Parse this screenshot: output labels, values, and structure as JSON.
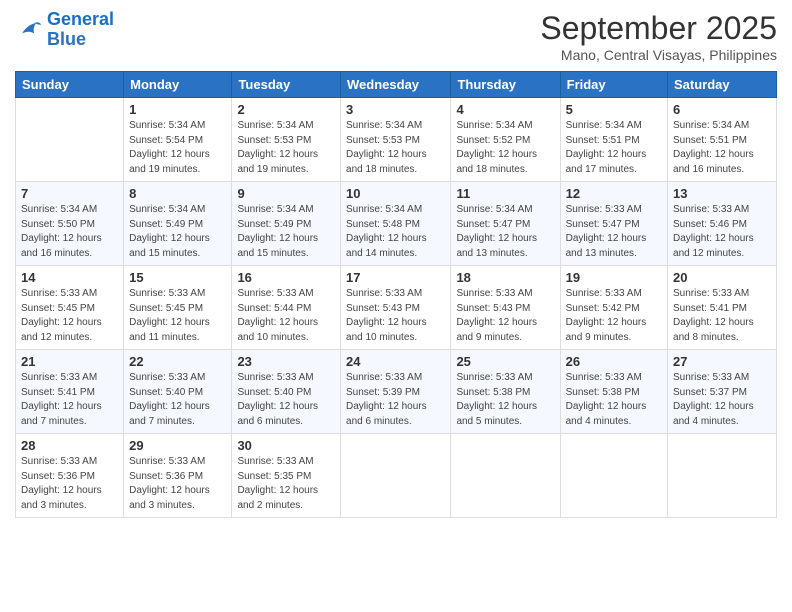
{
  "header": {
    "logo_line1": "General",
    "logo_line2": "Blue",
    "month": "September 2025",
    "location": "Mano, Central Visayas, Philippines"
  },
  "days_of_week": [
    "Sunday",
    "Monday",
    "Tuesday",
    "Wednesday",
    "Thursday",
    "Friday",
    "Saturday"
  ],
  "weeks": [
    [
      null,
      {
        "day": 1,
        "sunrise": "5:34 AM",
        "sunset": "5:54 PM",
        "daylight": "12 hours and 19 minutes."
      },
      {
        "day": 2,
        "sunrise": "5:34 AM",
        "sunset": "5:53 PM",
        "daylight": "12 hours and 19 minutes."
      },
      {
        "day": 3,
        "sunrise": "5:34 AM",
        "sunset": "5:53 PM",
        "daylight": "12 hours and 18 minutes."
      },
      {
        "day": 4,
        "sunrise": "5:34 AM",
        "sunset": "5:52 PM",
        "daylight": "12 hours and 18 minutes."
      },
      {
        "day": 5,
        "sunrise": "5:34 AM",
        "sunset": "5:51 PM",
        "daylight": "12 hours and 17 minutes."
      },
      {
        "day": 6,
        "sunrise": "5:34 AM",
        "sunset": "5:51 PM",
        "daylight": "12 hours and 16 minutes."
      }
    ],
    [
      {
        "day": 7,
        "sunrise": "5:34 AM",
        "sunset": "5:50 PM",
        "daylight": "12 hours and 16 minutes."
      },
      {
        "day": 8,
        "sunrise": "5:34 AM",
        "sunset": "5:49 PM",
        "daylight": "12 hours and 15 minutes."
      },
      {
        "day": 9,
        "sunrise": "5:34 AM",
        "sunset": "5:49 PM",
        "daylight": "12 hours and 15 minutes."
      },
      {
        "day": 10,
        "sunrise": "5:34 AM",
        "sunset": "5:48 PM",
        "daylight": "12 hours and 14 minutes."
      },
      {
        "day": 11,
        "sunrise": "5:34 AM",
        "sunset": "5:47 PM",
        "daylight": "12 hours and 13 minutes."
      },
      {
        "day": 12,
        "sunrise": "5:33 AM",
        "sunset": "5:47 PM",
        "daylight": "12 hours and 13 minutes."
      },
      {
        "day": 13,
        "sunrise": "5:33 AM",
        "sunset": "5:46 PM",
        "daylight": "12 hours and 12 minutes."
      }
    ],
    [
      {
        "day": 14,
        "sunrise": "5:33 AM",
        "sunset": "5:45 PM",
        "daylight": "12 hours and 12 minutes."
      },
      {
        "day": 15,
        "sunrise": "5:33 AM",
        "sunset": "5:45 PM",
        "daylight": "12 hours and 11 minutes."
      },
      {
        "day": 16,
        "sunrise": "5:33 AM",
        "sunset": "5:44 PM",
        "daylight": "12 hours and 10 minutes."
      },
      {
        "day": 17,
        "sunrise": "5:33 AM",
        "sunset": "5:43 PM",
        "daylight": "12 hours and 10 minutes."
      },
      {
        "day": 18,
        "sunrise": "5:33 AM",
        "sunset": "5:43 PM",
        "daylight": "12 hours and 9 minutes."
      },
      {
        "day": 19,
        "sunrise": "5:33 AM",
        "sunset": "5:42 PM",
        "daylight": "12 hours and 9 minutes."
      },
      {
        "day": 20,
        "sunrise": "5:33 AM",
        "sunset": "5:41 PM",
        "daylight": "12 hours and 8 minutes."
      }
    ],
    [
      {
        "day": 21,
        "sunrise": "5:33 AM",
        "sunset": "5:41 PM",
        "daylight": "12 hours and 7 minutes."
      },
      {
        "day": 22,
        "sunrise": "5:33 AM",
        "sunset": "5:40 PM",
        "daylight": "12 hours and 7 minutes."
      },
      {
        "day": 23,
        "sunrise": "5:33 AM",
        "sunset": "5:40 PM",
        "daylight": "12 hours and 6 minutes."
      },
      {
        "day": 24,
        "sunrise": "5:33 AM",
        "sunset": "5:39 PM",
        "daylight": "12 hours and 6 minutes."
      },
      {
        "day": 25,
        "sunrise": "5:33 AM",
        "sunset": "5:38 PM",
        "daylight": "12 hours and 5 minutes."
      },
      {
        "day": 26,
        "sunrise": "5:33 AM",
        "sunset": "5:38 PM",
        "daylight": "12 hours and 4 minutes."
      },
      {
        "day": 27,
        "sunrise": "5:33 AM",
        "sunset": "5:37 PM",
        "daylight": "12 hours and 4 minutes."
      }
    ],
    [
      {
        "day": 28,
        "sunrise": "5:33 AM",
        "sunset": "5:36 PM",
        "daylight": "12 hours and 3 minutes."
      },
      {
        "day": 29,
        "sunrise": "5:33 AM",
        "sunset": "5:36 PM",
        "daylight": "12 hours and 3 minutes."
      },
      {
        "day": 30,
        "sunrise": "5:33 AM",
        "sunset": "5:35 PM",
        "daylight": "12 hours and 2 minutes."
      },
      null,
      null,
      null,
      null
    ]
  ]
}
